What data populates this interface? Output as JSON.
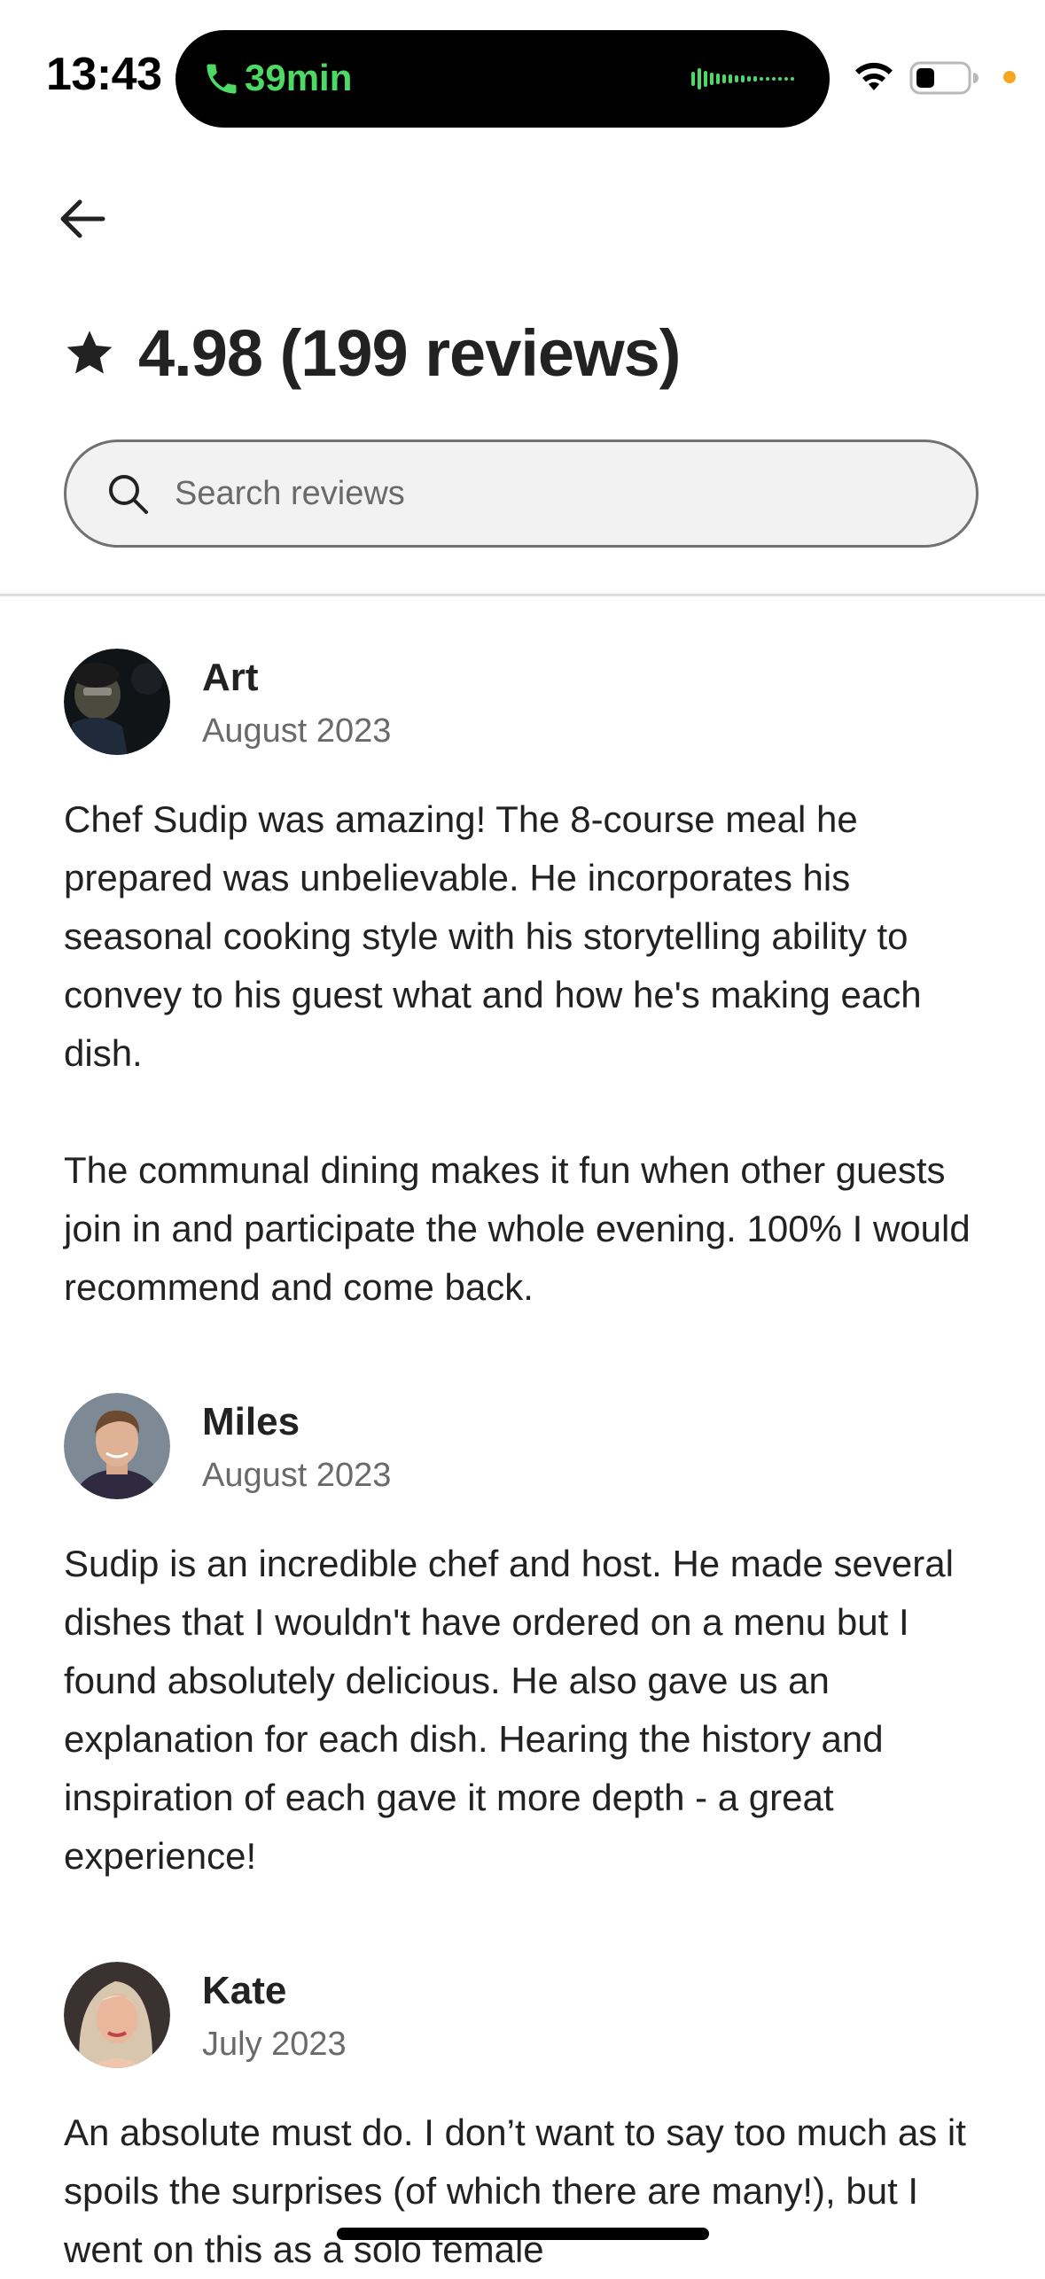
{
  "status_bar": {
    "time": "13:43",
    "call_duration": "39min",
    "call_color": "#4cd964",
    "privacy_dot_color": "#f5a623"
  },
  "header": {
    "back_icon": "arrow-left-icon",
    "star_icon": "star-icon",
    "rating_text": "4.98 (199 reviews)"
  },
  "search": {
    "placeholder": "Search reviews",
    "value": ""
  },
  "reviews": [
    {
      "name": "Art",
      "date": "August 2023",
      "paragraphs": [
        "Chef Sudip was amazing! The 8-course meal he prepared was unbelievable. He incorporates his seasonal cooking style with his storytelling ability to convey to his guest what and how he's making each dish.",
        "The communal dining makes it fun when other guests join in and participate the whole evening. 100% I would recommend and come back."
      ]
    },
    {
      "name": "Miles",
      "date": "August 2023",
      "paragraphs": [
        "Sudip is an incredible chef and host. He made several dishes that I wouldn't have ordered on a menu but I found absolutely delicious. He also gave us an explanation for each dish. Hearing the history and inspiration of each gave it more depth - a great experience!"
      ]
    },
    {
      "name": "Kate",
      "date": "July 2023",
      "paragraphs": [
        "An absolute must do. I don’t want to say too much as it spoils the surprises (of which there are many!), but I went on this as a solo female"
      ]
    }
  ]
}
